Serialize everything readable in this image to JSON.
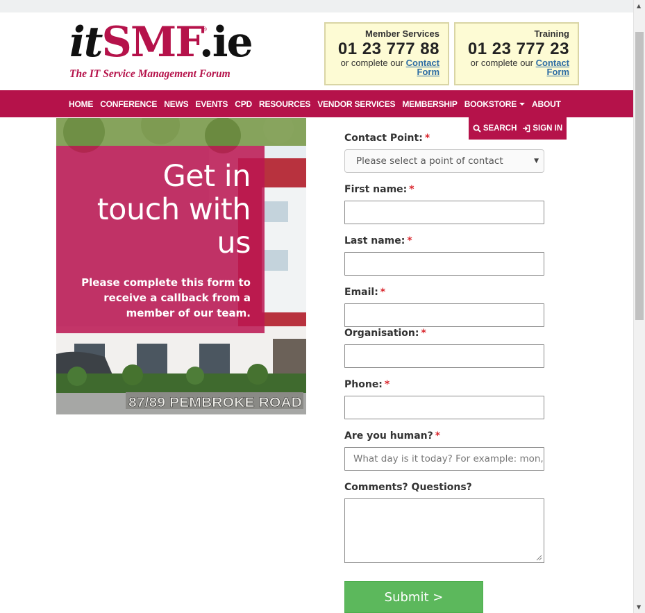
{
  "header": {
    "logo": {
      "it": "it",
      "smf": "SMF",
      "ie": ".ie",
      "reg": "®",
      "tagline": "The IT Service Management Forum"
    },
    "member_services": {
      "title": "Member Services",
      "phone": "01 23 777 88",
      "prefix": "or complete our",
      "link_line1": "Contact",
      "link_line2": "Form"
    },
    "training": {
      "title": "Training",
      "phone": "01 23 777 23",
      "prefix": "or complete our",
      "link_line1": "Contact",
      "link_line2": "Form"
    }
  },
  "nav": {
    "items": [
      "HOME",
      "CONFERENCE",
      "NEWS",
      "EVENTS",
      "CPD",
      "RESOURCES",
      "VENDOR SERVICES",
      "MEMBERSHIP",
      "BOOKSTORE",
      "ABOUT"
    ],
    "search": "SEARCH",
    "sign_in": "SIGN IN"
  },
  "hero": {
    "heading_line1": "Get in",
    "heading_line2": "touch with",
    "heading_line3": "us",
    "sub_line1": "Please complete this form to",
    "sub_line2": "receive a callback from a",
    "sub_line3": "member of our team.",
    "sign_text": "87/89 PEMBROKE ROAD"
  },
  "form": {
    "required_mark": "*",
    "contact_point": {
      "label": "Contact Point:",
      "value": "Please select a point of contact"
    },
    "first_name": {
      "label": "First name:"
    },
    "last_name": {
      "label": "Last name:"
    },
    "email": {
      "label": "Email:"
    },
    "organisation": {
      "label": "Organisation:"
    },
    "phone": {
      "label": "Phone:"
    },
    "human": {
      "label": "Are you human?",
      "placeholder": "What day is it today? For example: mon,tue"
    },
    "comments": {
      "label": "Comments? Questions?"
    },
    "submit": "Submit  >"
  },
  "colors": {
    "brand": "#b5124a",
    "contact_box": "#fdfbd4",
    "submit": "#5cb85c",
    "link": "#2e6da4"
  },
  "icons": {
    "search": "search-icon",
    "sign_in": "sign-in-icon",
    "caret": "caret-down-icon",
    "select_arrow": "select-arrow-icon"
  }
}
